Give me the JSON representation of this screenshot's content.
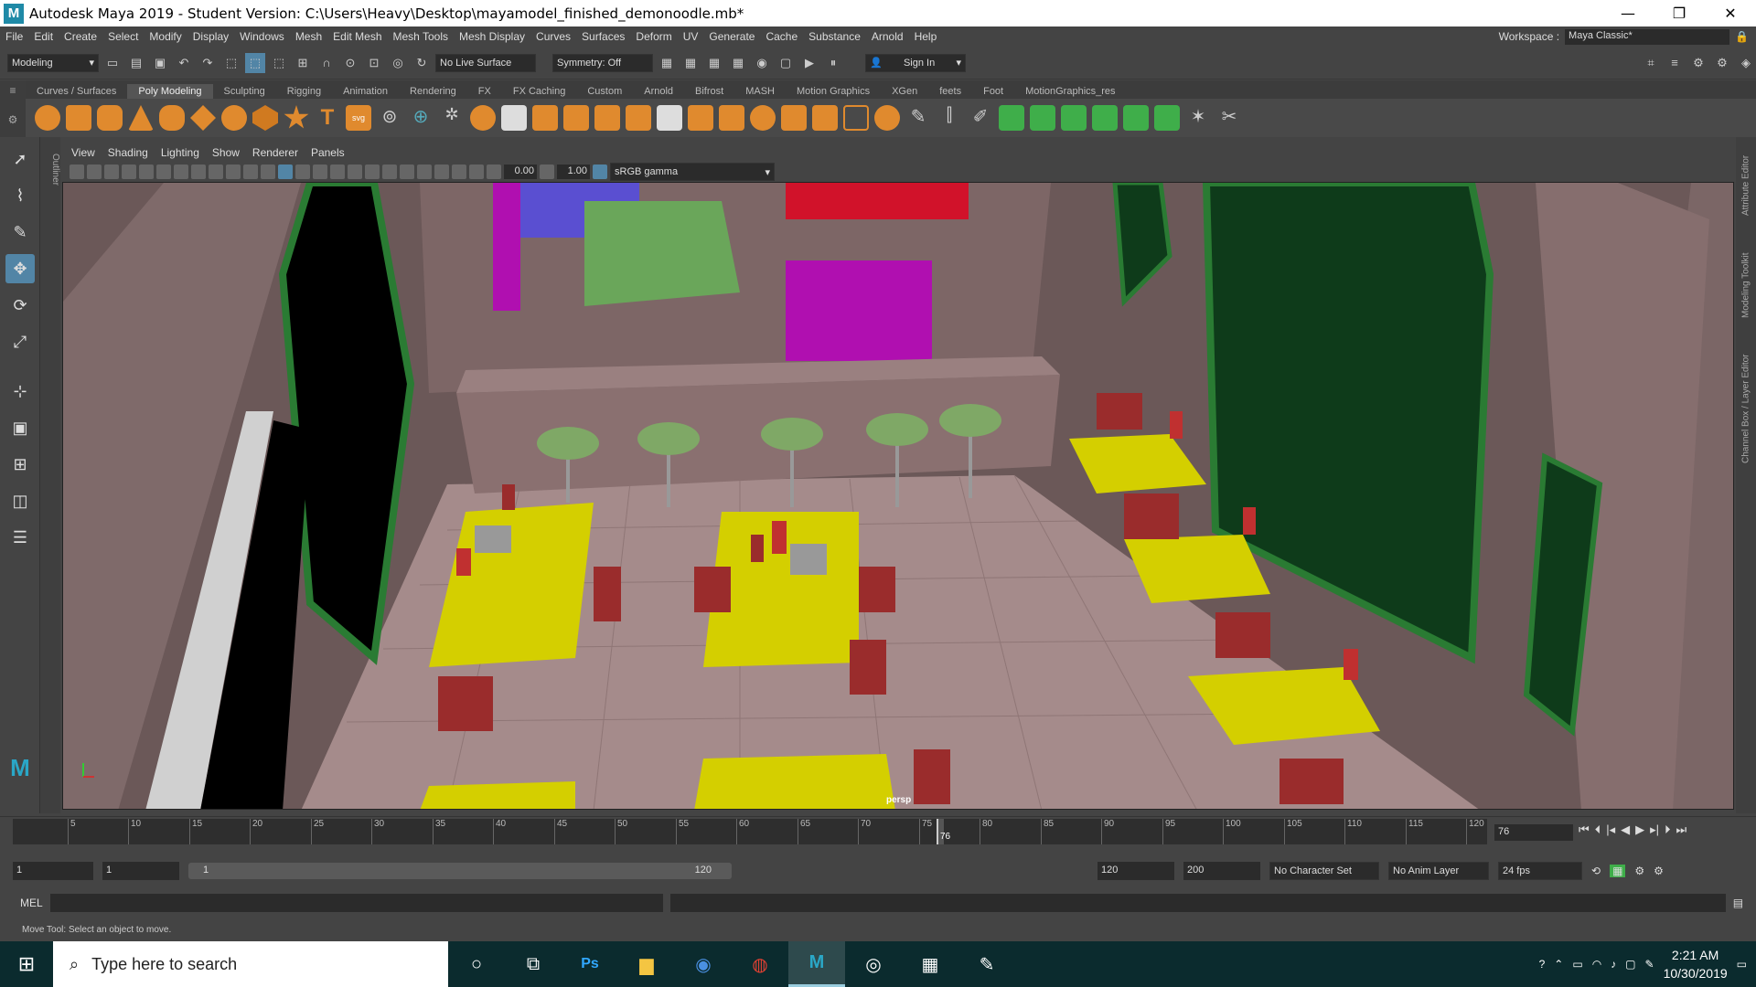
{
  "titlebar": {
    "title": "Autodesk Maya 2019 - Student Version: C:\\Users\\Heavy\\Desktop\\mayamodel_finished_demonoodle.mb*",
    "minimize": "—",
    "maximize": "❐",
    "close": "✕"
  },
  "menubar": {
    "items": [
      "File",
      "Edit",
      "Create",
      "Select",
      "Modify",
      "Display",
      "Windows",
      "Mesh",
      "Edit Mesh",
      "Mesh Tools",
      "Mesh Display",
      "Curves",
      "Surfaces",
      "Deform",
      "UV",
      "Generate",
      "Cache",
      "Substance",
      "Arnold",
      "Help"
    ],
    "workspace_label": "Workspace :",
    "workspace_value": "Maya Classic*"
  },
  "statusline": {
    "mode": "Modeling",
    "live_surface": "No Live Surface",
    "symmetry": "Symmetry: Off",
    "sign_in": "Sign In"
  },
  "shelf": {
    "tabs": [
      "Curves / Surfaces",
      "Poly Modeling",
      "Sculpting",
      "Rigging",
      "Animation",
      "Rendering",
      "FX",
      "FX Caching",
      "Custom",
      "Arnold",
      "Bifrost",
      "MASH",
      "Motion Graphics",
      "XGen",
      "feets",
      "Foot",
      "MotionGraphics_res"
    ],
    "active_tab": "Poly Modeling"
  },
  "outliner_label": "Outliner",
  "panel": {
    "menus": [
      "View",
      "Shading",
      "Lighting",
      "Show",
      "Renderer",
      "Panels"
    ],
    "exposure": "0.00",
    "gamma": "1.00",
    "colorspace": "sRGB gamma"
  },
  "viewport": {
    "camera": "persp"
  },
  "rightdock": {
    "tabs": [
      "Channel Box / Layer Editor",
      "Modeling Toolkit",
      "Attribute Editor"
    ]
  },
  "timeline": {
    "ticks": [
      "5",
      "10",
      "15",
      "20",
      "25",
      "30",
      "35",
      "40",
      "45",
      "50",
      "55",
      "60",
      "65",
      "70",
      "75",
      "80",
      "85",
      "90",
      "95",
      "100",
      "105",
      "110",
      "115",
      "120"
    ],
    "current": "76",
    "current_field": "76"
  },
  "range": {
    "start": "1",
    "start2": "1",
    "slider_start": "1",
    "slider_end": "120",
    "end": "120",
    "end2": "200",
    "char_set": "No Character Set",
    "anim_layer": "No Anim Layer",
    "fps": "24 fps"
  },
  "cmdline": {
    "label": "MEL"
  },
  "helpline": {
    "text": "Move Tool: Select an object to move."
  },
  "taskbar": {
    "search_placeholder": "Type here to search",
    "time": "2:21 AM",
    "date": "10/30/2019"
  },
  "colors": {
    "floor": "#a58b8b",
    "wall": "#7a6262",
    "table": "#d4cf00",
    "chair": "#9a2c2c",
    "stool": "#7fa866",
    "window": "#1f5e2a",
    "accent": "#5285a6"
  }
}
